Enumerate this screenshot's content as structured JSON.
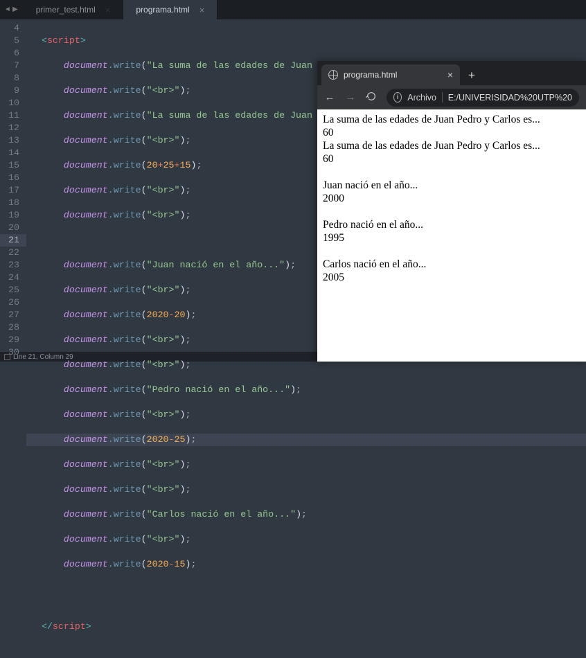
{
  "editor": {
    "tabs": [
      {
        "label": "primer_test.html"
      },
      {
        "label": "programa.html"
      }
    ],
    "statusbar": "Line 21, Column 29",
    "code": {
      "open_tag_name": "script",
      "close_tag_name": "script",
      "doc": "document",
      "method": ".write",
      "strings": {
        "s4": "\"La suma de las edades de Juan Pedro y Carlos es...<br>\"",
        "s6": "\"La suma de las edades de Juan Pedro y Carlos es...\"",
        "br": "\"<br>\"",
        "s14": "\"Juan nació en el año...\"",
        "s19": "\"Pedro nació en el año...\"",
        "s24": "\"Carlos nació en el año...\""
      },
      "nums": {
        "n20": "20",
        "n25": "25",
        "n15": "15",
        "y2020a": "2020",
        "y20": "20",
        "y2020b": "2020",
        "y25": "25",
        "y2020c": "2020",
        "y15": "15"
      },
      "line_numbers": [
        "4",
        "5",
        "6",
        "7",
        "8",
        "9",
        "10",
        "11",
        "12",
        "13",
        "14",
        "15",
        "16",
        "17",
        "18",
        "19",
        "20",
        "21",
        "22",
        "23",
        "24",
        "25",
        "26",
        "27",
        "28",
        "29",
        "30"
      ],
      "current_line": "21"
    }
  },
  "browser": {
    "tab_title": "programa.html",
    "url_label": "Archivo",
    "url_path": "E:/UNIVERISIDAD%20UTP%20",
    "render": {
      "l1": "La suma de las edades de Juan Pedro y Carlos es...",
      "l2": "60",
      "l3": "La suma de las edades de Juan Pedro y Carlos es...",
      "l4": "60",
      "l5": "Juan nació en el año...",
      "l6": "2000",
      "l7": "Pedro nació en el año...",
      "l8": "1995",
      "l9": "Carlos nació en el año...",
      "l10": "2005"
    }
  }
}
